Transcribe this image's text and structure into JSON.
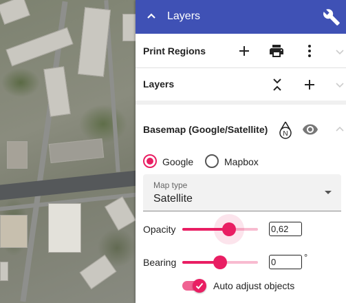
{
  "header": {
    "title": "Layers"
  },
  "sections": {
    "print_regions": {
      "label": "Print Regions"
    },
    "layers": {
      "label": "Layers"
    },
    "basemap": {
      "label": "Basemap (Google/Satellite)",
      "providers": [
        {
          "label": "Google",
          "selected": true
        },
        {
          "label": "Mapbox",
          "selected": false
        }
      ],
      "map_type": {
        "label": "Map type",
        "value": "Satellite"
      },
      "opacity": {
        "label": "Opacity",
        "value": "0,62",
        "level": 0.62
      },
      "bearing": {
        "label": "Bearing",
        "value": "0",
        "unit": "°",
        "level": 0.5
      },
      "auto_adjust": {
        "label": "Auto adjust objects",
        "checked": true
      }
    }
  },
  "colors": {
    "header": "#3f51b5",
    "accent": "#e91e63"
  },
  "icons": [
    "chevron-up-icon",
    "wrench-icon",
    "plus-icon",
    "printer-icon",
    "more-vert-icon",
    "expand-collapse-icon",
    "north-arrow-icon",
    "eye-icon",
    "chevron-down-icon",
    "check-icon"
  ]
}
